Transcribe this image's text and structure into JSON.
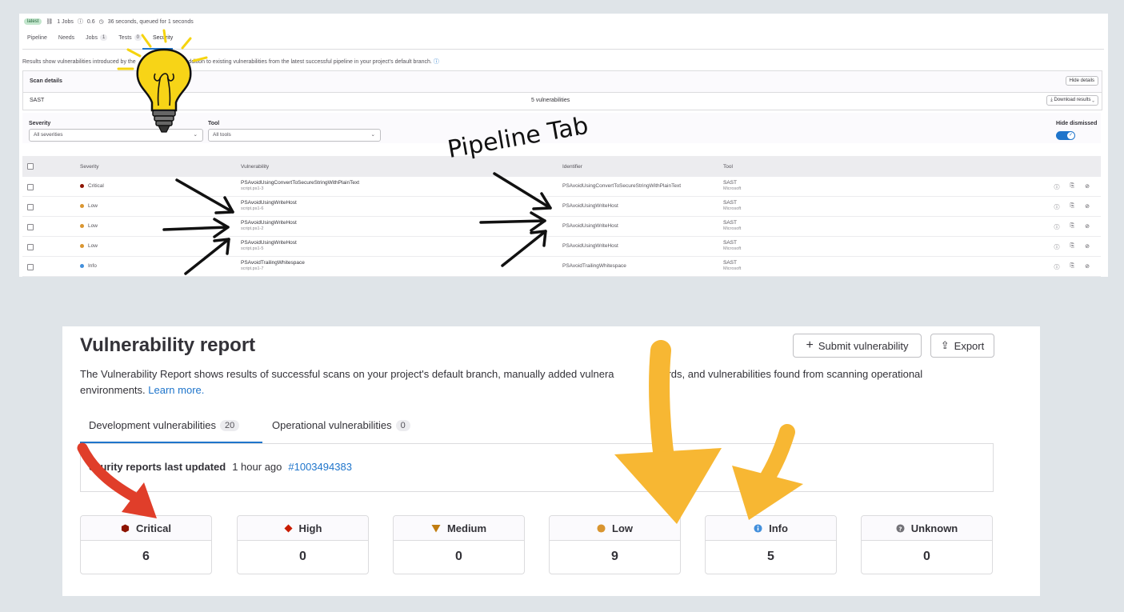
{
  "pipeline_panel": {
    "header": {
      "badge": "latest",
      "jobs": "1 Jobs",
      "version": "0.6",
      "duration": "36 seconds, queued for 1 seconds"
    },
    "tabs": [
      {
        "label": "Pipeline",
        "count": ""
      },
      {
        "label": "Needs",
        "count": ""
      },
      {
        "label": "Jobs",
        "count": "1"
      },
      {
        "label": "Tests",
        "count": "0"
      },
      {
        "label": "Security",
        "count": ""
      }
    ],
    "info_text_start": "Results show vulnerabilities introduced by the",
    "info_text_end": "addition to existing vulnerabilities from the latest successful pipeline in your project's default branch.",
    "help_icon": "question-circle-icon",
    "scan_details": {
      "title": "Scan details",
      "hide_button": "Hide details",
      "scanner": "SAST",
      "count": "5 vulnerabilities",
      "download_button": "Download results"
    },
    "filters": {
      "severity_label": "Severity",
      "severity_value": "All severities",
      "tool_label": "Tool",
      "tool_value": "All tools",
      "dismissed_label": "Hide dismissed"
    },
    "table": {
      "headers": {
        "severity": "Severity",
        "vulnerability": "Vulnerability",
        "identifier": "Identifier",
        "tool": "Tool"
      },
      "rows": [
        {
          "severity": "Critical",
          "color": "#8d1300",
          "name": "PSAvoidUsingConvertToSecureStringWithPlainText",
          "file": "script.ps1-3",
          "identifier": "PSAvoidUsingConvertToSecureStringWithPlainText",
          "tool": "SAST",
          "vendor": "Microsoft"
        },
        {
          "severity": "Low",
          "color": "#d99530",
          "name": "PSAvoidUsingWriteHost",
          "file": "script.ps1-6",
          "identifier": "PSAvoidUsingWriteHost",
          "tool": "SAST",
          "vendor": "Microsoft"
        },
        {
          "severity": "Low",
          "color": "#d99530",
          "name": "PSAvoidUsingWriteHost",
          "file": "script.ps1-2",
          "identifier": "PSAvoidUsingWriteHost",
          "tool": "SAST",
          "vendor": "Microsoft"
        },
        {
          "severity": "Low",
          "color": "#d99530",
          "name": "PSAvoidUsingWriteHost",
          "file": "script.ps1-5",
          "identifier": "PSAvoidUsingWriteHost",
          "tool": "SAST",
          "vendor": "Microsoft"
        },
        {
          "severity": "Info",
          "color": "#428fdc",
          "name": "PSAvoidTrailingWhitespace",
          "file": "script.ps1-7",
          "identifier": "PSAvoidTrailingWhitespace",
          "tool": "SAST",
          "vendor": "Microsoft"
        }
      ]
    },
    "annotation": "Pipeline Tab"
  },
  "report_panel": {
    "title": "Vulnerability report",
    "submit_button": "Submit vulnerability",
    "export_button": "Export",
    "description": "The Vulnerability Report shows results of successful scans on your project's default branch, manually added vulnera",
    "description_mid": "ecords, and vulnerabilities found from scanning operational environments.",
    "learn_more": "Learn more.",
    "tabs": [
      {
        "label": "Development vulnerabilities",
        "count": "20"
      },
      {
        "label": "Operational vulnerabilities",
        "count": "0"
      }
    ],
    "updated_label": "ecurity reports last updated",
    "updated_time": "1 hour ago",
    "updated_link": "#1003494383",
    "severity_cards": [
      {
        "label": "Critical",
        "count": "6",
        "icon": "critical-hexagon-icon",
        "color": "#8d1300"
      },
      {
        "label": "High",
        "count": "0",
        "icon": "high-diamond-icon",
        "color": "#c91c00"
      },
      {
        "label": "Medium",
        "count": "0",
        "icon": "medium-triangle-icon",
        "color": "#c17d10"
      },
      {
        "label": "Low",
        "count": "9",
        "icon": "low-circle-icon",
        "color": "#d99530"
      },
      {
        "label": "Info",
        "count": "5",
        "icon": "info-circle-icon",
        "color": "#428fdc"
      },
      {
        "label": "Unknown",
        "count": "0",
        "icon": "unknown-circle-icon",
        "color": "#737278"
      }
    ]
  }
}
